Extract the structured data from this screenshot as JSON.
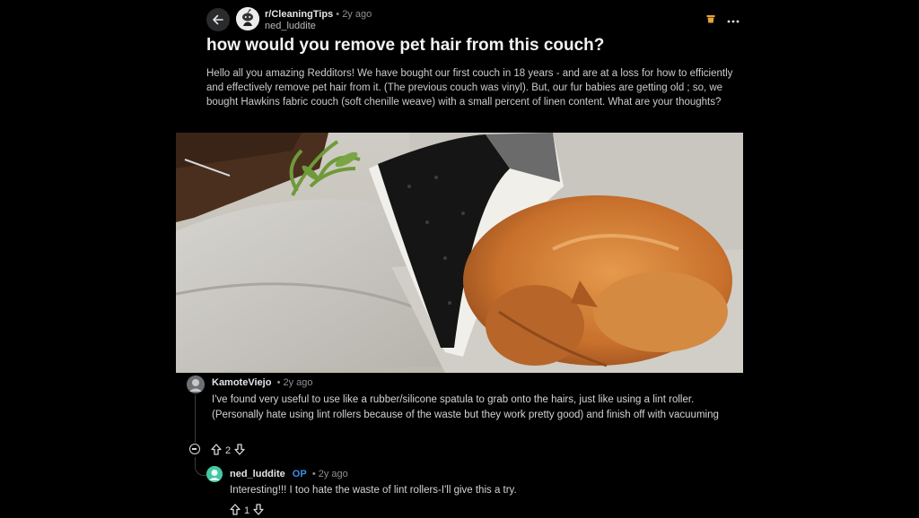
{
  "post": {
    "subreddit": "r/CleaningTips",
    "separator": "•",
    "age": "2y ago",
    "author": "ned_luddite",
    "title": "how would you remove pet hair from this couch?",
    "body": "Hello all you amazing Redditors! We have bought our first couch in 18 years - and are at a loss for how to efficiently and effectively remove pet hair from it. (The previous couch was vinyl). But, our fur babies are getting old ; so, we bought Hawkins fabric couch (soft chenille weave) with a small percent of linen content. What are your thoughts?"
  },
  "comment": {
    "author": "KamoteViejo",
    "separator": "•",
    "age": "2y ago",
    "text": "I've found very useful to use like a rubber/silicone spatula to grab onto the hairs, just like using a lint roller. (Personally hate using lint rollers because of the waste but they work pretty good) and finish off with vacuuming",
    "score": "2"
  },
  "reply": {
    "author": "ned_luddite",
    "op_badge": "OP",
    "separator": "•",
    "age": "2y ago",
    "text": "Interesting!!! I too hate the waste of lint rollers-I'll give this a try.",
    "score": "1"
  },
  "icons": {
    "back": "arrow-left-icon",
    "mod": "trash-icon",
    "more": "more-horizontal-icon",
    "upvote": "arrow-up-outline-icon",
    "downvote": "arrow-down-outline-icon",
    "collapse": "minus-circle-icon"
  },
  "colors": {
    "background": "#000000",
    "op_badge": "#3d8ee8",
    "mod_icon": "#e8a33d"
  }
}
